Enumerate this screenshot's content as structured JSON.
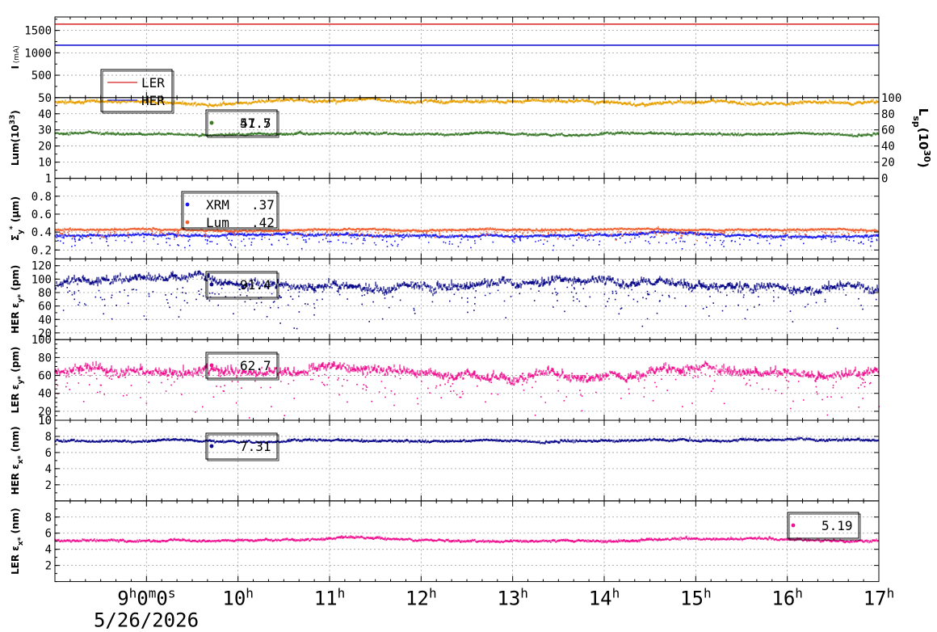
{
  "chart_data": {
    "type": "scatter",
    "time_axis": {
      "range": [
        "2026-05-26 08:00",
        "2026-05-26 17:00"
      ],
      "major_ticks": [
        {
          "time": "09:00",
          "label": "9",
          "sup": "h",
          "label2": "0",
          "sup2": "m",
          "label3": "0",
          "sup3": "s"
        },
        {
          "time": "10:00",
          "label": "10",
          "sup": "h"
        },
        {
          "time": "11:00",
          "label": "11",
          "sup": "h"
        },
        {
          "time": "12:00",
          "label": "12",
          "sup": "h"
        },
        {
          "time": "13:00",
          "label": "13",
          "sup": "h"
        },
        {
          "time": "14:00",
          "label": "14",
          "sup": "h"
        },
        {
          "time": "15:00",
          "label": "15",
          "sup": "h"
        },
        {
          "time": "16:00",
          "label": "16",
          "sup": "h"
        },
        {
          "time": "17:00",
          "label": "17",
          "sup": "h"
        }
      ],
      "date_label": "5/26/2026"
    },
    "panels": [
      {
        "id": "current",
        "ylabel": "I",
        "ylabel_unit": "(mA)",
        "ylim": [
          0,
          1800
        ],
        "yticks": [
          500,
          1000,
          1500
        ],
        "legend": {
          "position": "bottom-left",
          "entries": [
            {
              "label": "LER",
              "style": "line",
              "color": "#d62020"
            },
            {
              "label": "HER",
              "style": "line",
              "color": "#1a1ad6"
            }
          ]
        },
        "series": [
          {
            "name": "LER",
            "color": "#d62020",
            "mean": 1640,
            "noise": 4
          },
          {
            "name": "HER",
            "color": "#1a1ad6",
            "mean": 1170,
            "noise": 4
          }
        ]
      },
      {
        "id": "lum",
        "ylabel": "Lum(10",
        "ylabel_sup": "33",
        "ylabel_end": ")",
        "ylim": [
          0,
          50
        ],
        "yticks": [
          10,
          20,
          30,
          40,
          50
        ],
        "right_axis": {
          "label": "L",
          "label_sub": "sp",
          "label_mid": "(10",
          "label_sup": "30",
          "label_end": ")",
          "ylim": [
            0,
            100
          ],
          "yticks": [
            0,
            20,
            40,
            60,
            80,
            100
          ]
        },
        "legend": {
          "position": "top-left",
          "entries": [
            {
              "label": "47.5",
              "style": "dot",
              "color": "#e8a000"
            },
            {
              "label": "51.7",
              "style": "dot",
              "color": "#3a7a2a"
            }
          ]
        },
        "series": [
          {
            "name": "Lum",
            "color": "#e8a000",
            "mean": 46.5,
            "noise": 0.8
          },
          {
            "name": "Lsp",
            "color": "#3a7a2a",
            "mean": 27,
            "noise": 0.6
          }
        ]
      },
      {
        "id": "sigma",
        "ylabel": "Σ",
        "ylabel_sub": "y",
        "ylabel_sup": "*",
        "ylabel_unit": "(μm)",
        "ylim": [
          0.1,
          1.0
        ],
        "yticks": [
          0.2,
          0.4,
          0.6,
          0.8,
          1
        ],
        "legend": {
          "position": "top-left",
          "entries": [
            {
              "label": "XRM",
              "value": ".37",
              "style": "dot",
              "color": "#1a1af0"
            },
            {
              "label": "Lum",
              "value": ".42",
              "style": "dot",
              "color": "#f06030"
            }
          ]
        },
        "series": [
          {
            "name": "XRM",
            "color": "#1a1af0",
            "mean": 0.35,
            "noise": 0.012
          },
          {
            "name": "Lum",
            "color": "#f06030",
            "mean": 0.41,
            "noise": 0.008
          }
        ]
      },
      {
        "id": "her_eps_y",
        "ylabel": "HER ε",
        "ylabel_sub": "y*",
        "ylabel_unit": "(pm)",
        "ylim": [
          10,
          130
        ],
        "yticks": [
          20,
          40,
          60,
          80,
          100,
          120
        ],
        "legend": {
          "position": "top-left",
          "entries": [
            {
              "label": "91.4",
              "style": "dot",
              "color": "#0a0a8a"
            }
          ]
        },
        "series": [
          {
            "name": "HER eps_y",
            "color": "#0a0a8a",
            "mean": 88,
            "noise": 5
          }
        ]
      },
      {
        "id": "ler_eps_y",
        "ylabel": "LER ε",
        "ylabel_sub": "y*",
        "ylabel_unit": "(pm)",
        "ylim": [
          10,
          100
        ],
        "yticks": [
          10,
          20,
          40,
          60,
          80,
          100
        ],
        "legend": {
          "position": "top-left",
          "entries": [
            {
              "label": "62.7",
              "style": "dot",
              "color": "#f01090"
            }
          ]
        },
        "series": [
          {
            "name": "LER eps_y",
            "color": "#f01090",
            "mean": 63,
            "noise": 4
          }
        ]
      },
      {
        "id": "her_eps_x",
        "ylabel": "HER ε",
        "ylabel_sub": "x*",
        "ylabel_unit": "(nm)",
        "ylim": [
          0,
          10
        ],
        "yticks": [
          2,
          4,
          6,
          8,
          10
        ],
        "legend": {
          "position": "top-left",
          "entries": [
            {
              "label": "7.31",
              "style": "dot",
              "color": "#0a0a8a"
            }
          ]
        },
        "series": [
          {
            "name": "HER eps_x",
            "color": "#0a0a8a",
            "mean": 7.35,
            "noise": 0.12
          }
        ]
      },
      {
        "id": "ler_eps_x",
        "ylabel": "LER ε",
        "ylabel_sub": "x*",
        "ylabel_unit": "(nm)",
        "ylim": [
          0,
          10
        ],
        "yticks": [
          2,
          4,
          6,
          8
        ],
        "legend": {
          "position": "right",
          "entries": [
            {
              "label": "5.19",
              "style": "dot",
              "color": "#f01090"
            }
          ]
        },
        "series": [
          {
            "name": "LER eps_x",
            "color": "#f01090",
            "mean": 5.0,
            "noise": 0.12
          }
        ]
      }
    ]
  }
}
